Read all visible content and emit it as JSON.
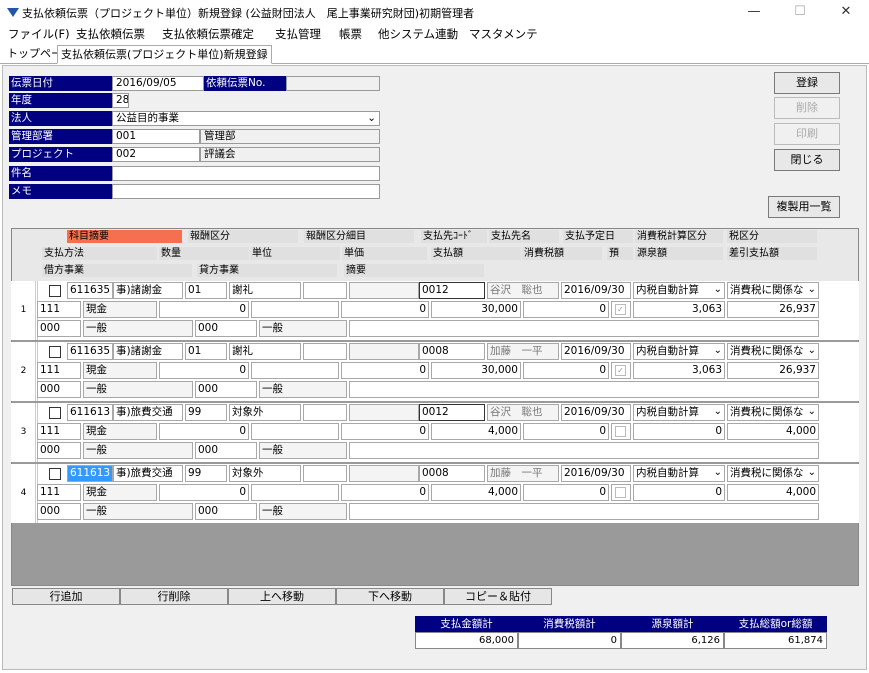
{
  "window": {
    "title": "支払依頼伝票（プロジェクト単位）新規登録 (公益財団法人　尾上事業研究財団)初期管理者",
    "minimize": "—",
    "maximize": "☐",
    "close": "✕"
  },
  "menu": [
    "ファイル(F)",
    "支払依頼伝票",
    "支払依頼伝票確定",
    "支払管理",
    "帳票",
    "他システム連動",
    "マスタメンテ"
  ],
  "tabs": [
    "トップページ",
    "支払依頼伝票(プロジェクト単位)新規登録"
  ],
  "header": {
    "date_label": "伝票日付",
    "date_value": "2016/09/05",
    "reqno_label": "依頼伝票No.",
    "reqno_value": "",
    "year_label": "年度",
    "year_value": "28",
    "corp_label": "法人",
    "corp_value": "公益目的事業",
    "dept_label": "管理部署",
    "dept_code": "001",
    "dept_name": "管理部",
    "proj_label": "プロジェクト",
    "proj_code": "002",
    "proj_name": "評議会",
    "subject_label": "件名",
    "subject_value": "",
    "memo_label": "メモ",
    "memo_value": ""
  },
  "buttons": {
    "register": "登録",
    "delete": "削除",
    "print": "印刷",
    "close": "閉じる",
    "copy_list": "複製用一覧"
  },
  "grid_headers": {
    "r1": [
      "科目摘要",
      "報酬区分",
      "報酬区分細目",
      "支払先ｺｰﾄﾞ",
      "支払先名",
      "支払予定日",
      "消費税計算区分",
      "税区分"
    ],
    "r2": [
      "支払方法",
      "数量",
      "単位",
      "単価",
      "支払額",
      "消費税額",
      "預",
      "源泉額",
      "差引支払額"
    ],
    "r3": [
      "借方事業",
      "貸方事業",
      "摘要"
    ]
  },
  "rows": [
    {
      "no": "1",
      "code": "611635",
      "acct": "事)諸謝金",
      "fee": "01",
      "fee_name": "謝礼",
      "payee_code": "0012",
      "payee_name": "谷沢　聡也",
      "date": "2016/09/30",
      "tax_calc": "内税自動計算",
      "tax_div": "消費税に関係な",
      "pay_method": "111",
      "pay_name": "現金",
      "qty": "0",
      "unit_price": "0",
      "amount": "30,000",
      "tax": "0",
      "withholding": "3,063",
      "net": "26,937",
      "debit_code": "000",
      "debit_name": "一般",
      "credit_code": "000",
      "credit_name": "一般",
      "checked": true
    },
    {
      "no": "2",
      "code": "611635",
      "acct": "事)諸謝金",
      "fee": "01",
      "fee_name": "謝礼",
      "payee_code": "0008",
      "payee_name": "加藤　一平",
      "date": "2016/09/30",
      "tax_calc": "内税自動計算",
      "tax_div": "消費税に関係な",
      "pay_method": "111",
      "pay_name": "現金",
      "qty": "0",
      "unit_price": "0",
      "amount": "30,000",
      "tax": "0",
      "withholding": "3,063",
      "net": "26,937",
      "debit_code": "000",
      "debit_name": "一般",
      "credit_code": "000",
      "credit_name": "一般",
      "checked": true
    },
    {
      "no": "3",
      "code": "611613",
      "acct": "事)旅費交通",
      "fee": "99",
      "fee_name": "対象外",
      "payee_code": "0012",
      "payee_name": "谷沢　聡也",
      "date": "2016/09/30",
      "tax_calc": "内税自動計算",
      "tax_div": "消費税に関係な",
      "pay_method": "111",
      "pay_name": "現金",
      "qty": "0",
      "unit_price": "0",
      "amount": "4,000",
      "tax": "0",
      "withholding": "0",
      "net": "4,000",
      "debit_code": "000",
      "debit_name": "一般",
      "credit_code": "000",
      "credit_name": "一般",
      "checked": false
    },
    {
      "no": "4",
      "code": "611613",
      "acct": "事)旅費交通",
      "fee": "99",
      "fee_name": "対象外",
      "payee_code": "0008",
      "payee_name": "加藤　一平",
      "date": "2016/09/30",
      "tax_calc": "内税自動計算",
      "tax_div": "消費税に関係な",
      "pay_method": "111",
      "pay_name": "現金",
      "qty": "0",
      "unit_price": "0",
      "amount": "4,000",
      "tax": "0",
      "withholding": "0",
      "net": "4,000",
      "debit_code": "000",
      "debit_name": "一般",
      "credit_code": "000",
      "credit_name": "一般",
      "checked": false
    }
  ],
  "row_buttons": [
    "行追加",
    "行削除",
    "上へ移動",
    "下へ移動",
    "コピー＆貼付"
  ],
  "totals": {
    "labels": [
      "支払金額計",
      "消費税額計",
      "源泉額計",
      "支払総額or総額"
    ],
    "values": [
      "68,000",
      "0",
      "6,126",
      "61,874"
    ]
  },
  "colors": {
    "label_bg": "#000080",
    "highlight": "#f4704f",
    "selection": "#3399ff"
  }
}
